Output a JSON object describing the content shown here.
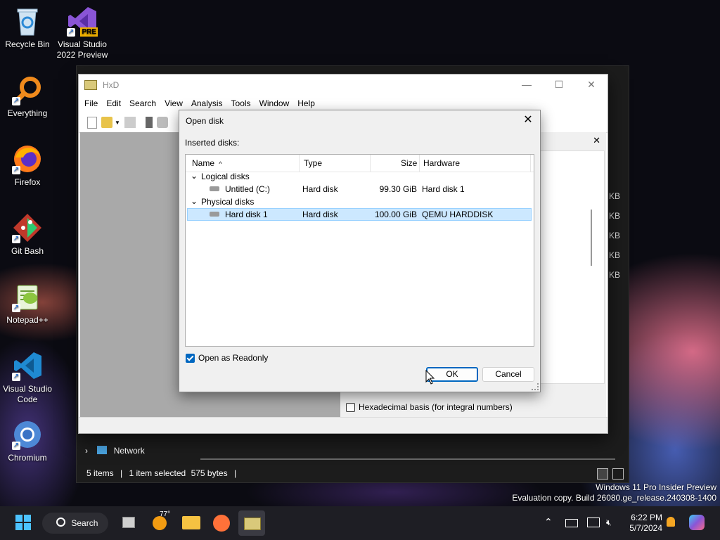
{
  "desktop": {
    "icons": [
      {
        "label": "Recycle Bin"
      },
      {
        "label": "Visual Studio 2022 Preview",
        "badge": "PRE"
      },
      {
        "label": "Everything"
      },
      {
        "label": "Firefox"
      },
      {
        "label": "Git Bash"
      },
      {
        "label": "Notepad++"
      },
      {
        "label": "Visual Studio Code"
      },
      {
        "label": "Chromium"
      }
    ],
    "watermark": {
      "line1": "Windows 11 Pro Insider Preview",
      "line2": "Evaluation copy. Build 26080.ge_release.240308-1400"
    }
  },
  "explorer": {
    "nav_network": "Network",
    "status": {
      "items": "5 items",
      "selected": "1 item selected",
      "size": "575 bytes"
    },
    "kb_label": "KB"
  },
  "hxd": {
    "title": "HxD",
    "menu": [
      "File",
      "Edit",
      "Search",
      "View",
      "Analysis",
      "Tools",
      "Window",
      "Help"
    ],
    "hex_checkbox_label": "Hexadecimal basis (for integral numbers)"
  },
  "dialog": {
    "title": "Open disk",
    "inserted_label": "Inserted disks:",
    "columns": {
      "name": "Name",
      "type": "Type",
      "size": "Size",
      "hardware": "Hardware"
    },
    "groups": [
      {
        "label": "Logical disks",
        "rows": [
          {
            "name": "Untitled (C:)",
            "type": "Hard disk",
            "size": "99.30 GiB",
            "hardware": "Hard disk 1",
            "selected": false
          }
        ]
      },
      {
        "label": "Physical disks",
        "rows": [
          {
            "name": "Hard disk 1",
            "type": "Hard disk",
            "size": "100.00 GiB",
            "hardware": "QEMU HARDDISK",
            "selected": true
          }
        ]
      }
    ],
    "readonly_label": "Open as Readonly",
    "readonly_checked": true,
    "ok_label": "OK",
    "cancel_label": "Cancel"
  },
  "taskbar": {
    "search_label": "Search",
    "weather_temp": "77°",
    "time": "6:22 PM",
    "date": "5/7/2024"
  },
  "colors": {
    "selection": "#cce8ff",
    "accent": "#0067c0",
    "taskbar": "#1e1e24"
  }
}
